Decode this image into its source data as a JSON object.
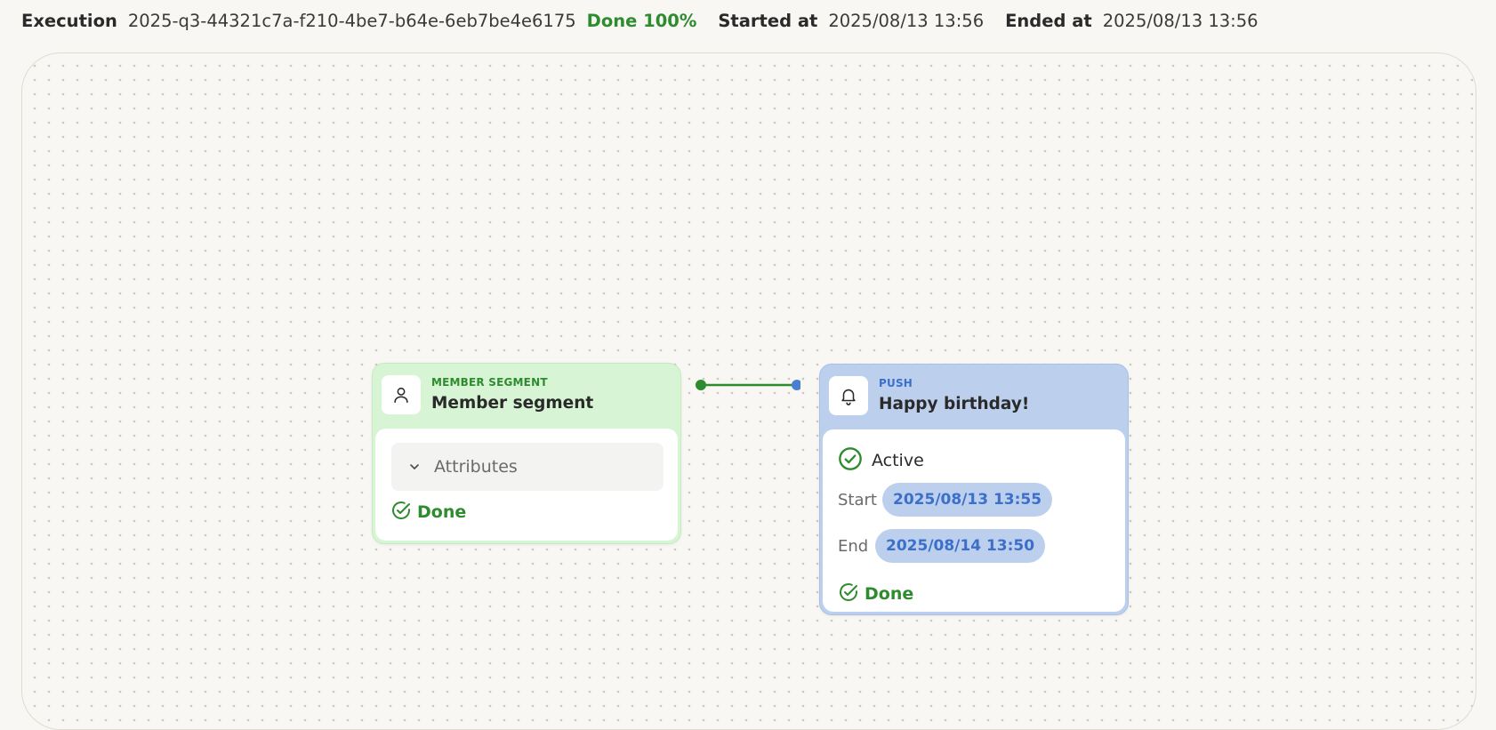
{
  "header": {
    "execution_label": "Execution",
    "execution_id": "2025-q3-44321c7a-f210-4be7-b64e-6eb7be4e6175",
    "status": "Done 100%",
    "started_label": "Started at",
    "started_value": "2025/08/13 13:56",
    "ended_label": "Ended at",
    "ended_value": "2025/08/13 13:56"
  },
  "nodes": {
    "segment": {
      "kind": "MEMBER SEGMENT",
      "title": "Member segment",
      "icon": "user-icon",
      "attributes_label": "Attributes",
      "status": "Done"
    },
    "push": {
      "kind": "PUSH",
      "title": "Happy birthday!",
      "icon": "bell-icon",
      "active_label": "Active",
      "start_label": "Start",
      "start_value": "2025/08/13 13:55",
      "end_label": "End",
      "end_value": "2025/08/14 13:50",
      "status": "Done"
    }
  },
  "colors": {
    "success_green": "#2e8b2e",
    "segment_bg": "#d7f5d5",
    "push_bg": "#bcd0ee",
    "push_accent": "#3b6fc9"
  }
}
